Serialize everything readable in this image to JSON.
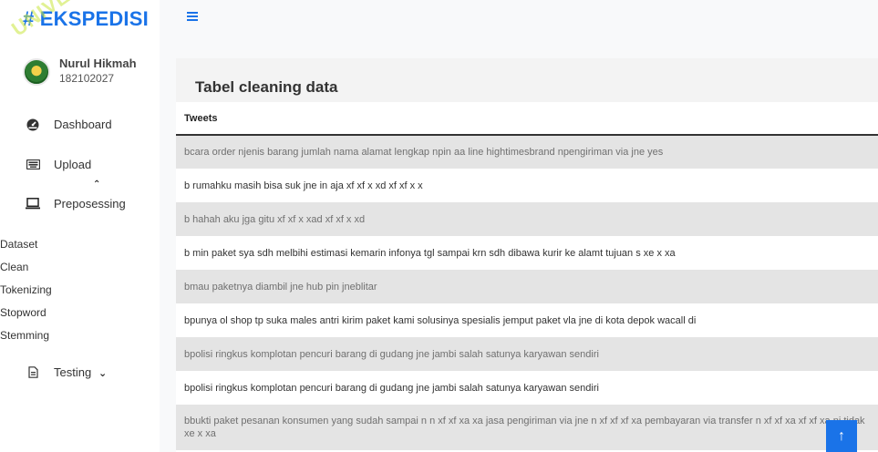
{
  "brand": {
    "title": "# EKSPEDISI",
    "watermark": "UNIVE"
  },
  "user": {
    "name": "Nurul Hikmah",
    "id": "182102027"
  },
  "sidebar": {
    "dashboard": "Dashboard",
    "upload": "Upload",
    "preposessing": "Preposessing",
    "sub_items": [
      "Dataset",
      "Clean",
      "Tokenizing",
      "Stopword",
      "Stemming"
    ],
    "testing": "Testing"
  },
  "card": {
    "title": "Tabel cleaning data"
  },
  "table": {
    "header": "Tweets",
    "rows": [
      "bcara order njenis barang jumlah nama alamat lengkap npin aa line hightimesbrand npengiriman via jne yes",
      "b rumahku masih bisa suk jne in aja xf xf x xd xf xf x x",
      "b hahah aku jga gitu xf xf x xad xf xf x xd",
      "b min paket sya sdh melbihi estimasi kemarin infonya tgl sampai krn sdh dibawa kurir ke alamt tujuan s xe x xa",
      "bmau paketnya diambil jne hub pin jneblitar",
      "bpunya ol shop tp suka males antri kirim paket kami solusinya spesialis jemput paket vla jne di kota depok wacall di",
      "bpolisi ringkus komplotan pencuri barang di gudang jne jambi salah satunya karyawan sendiri",
      "bpolisi ringkus komplotan pencuri barang di gudang jne jambi salah satunya karyawan sendiri",
      "bbukti paket pesanan konsumen yang sudah sampai n n xf xf xa xa jasa pengiriman via jne n xf xf xf xa pembayaran via transfer n xf xf xa xf xf xa ni tidak xe x xa"
    ]
  },
  "icons": {
    "menu": "hamburger-icon",
    "dashboard": "dashboard-gauge-icon",
    "upload": "keyboard-icon",
    "preposessing": "laptop-icon",
    "testing": "file-icon",
    "scroll_top": "arrow-up-icon"
  },
  "colors": {
    "accent": "#1a73e8"
  }
}
